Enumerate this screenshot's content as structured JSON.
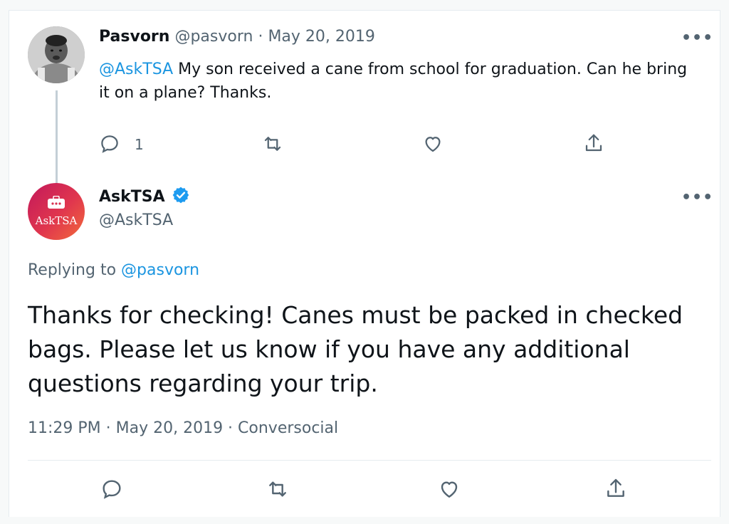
{
  "original_tweet": {
    "name": "Pasvorn",
    "handle": "@pasvorn",
    "separator": "·",
    "date": "May 20, 2019",
    "mention": "@AskTSA",
    "text_line1": " My son received a cane from school for graduation. Can he bring",
    "text_line2": "it on a plane? Thanks.",
    "reply_count": "1",
    "more_label": "•••"
  },
  "reply_tweet": {
    "name": "AskTSA",
    "handle": "@AskTSA",
    "avatar_text": "AskTSA",
    "replying_to_label": "Replying to",
    "replying_to_handle": "@pasvorn",
    "text_line1": "Thanks for checking! Canes must be packed in checked",
    "text_line2": "bags. Please let us know if you have any additional",
    "text_line3": "questions regarding your trip.",
    "meta": "11:29 PM · May 20, 2019 · Conversocial",
    "more_label": "•••"
  },
  "colors": {
    "link": "#1b95e0",
    "muted": "#536471",
    "verified": "#1d9bf0",
    "asktsa_gradient_start": "#c2185b",
    "asktsa_gradient_end": "#f26a3a"
  },
  "icons": [
    "reply-icon",
    "retweet-icon",
    "like-icon",
    "share-icon",
    "verified-badge-icon",
    "more-icon"
  ]
}
